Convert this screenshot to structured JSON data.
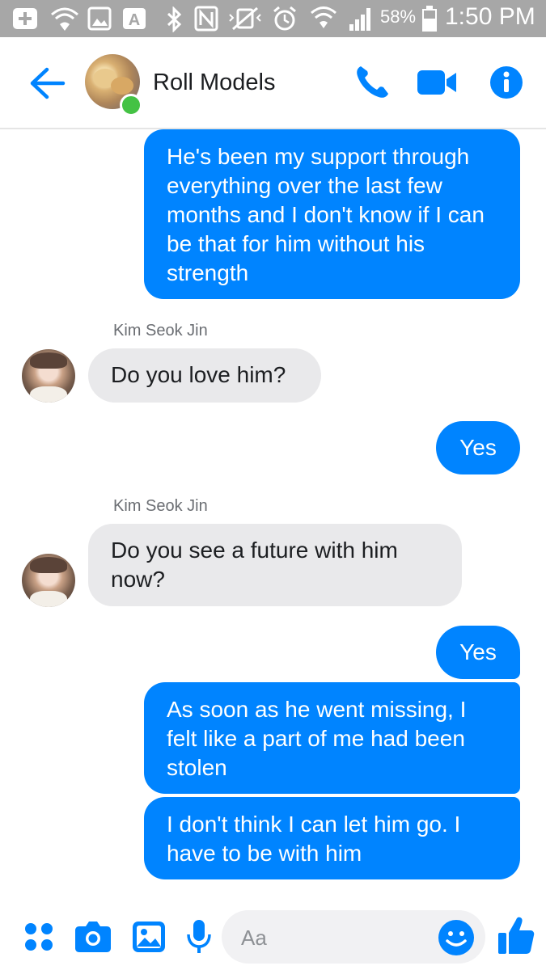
{
  "status_bar": {
    "battery_percent": "58%",
    "time": "1:50 PM"
  },
  "header": {
    "title": "Roll Models",
    "actions": [
      "call",
      "video-call",
      "info"
    ]
  },
  "messages": [
    {
      "direction": "outgoing",
      "text": "He's been my support through everything over the last few months and I don't know if I can be that for him without his strength"
    },
    {
      "direction": "incoming",
      "sender": "Kim Seok Jin",
      "text": "Do you love him?"
    },
    {
      "direction": "outgoing",
      "text": "Yes"
    },
    {
      "direction": "incoming",
      "sender": "Kim Seok Jin",
      "text": "Do you see a future with him now?"
    },
    {
      "direction": "outgoing",
      "text": "Yes"
    },
    {
      "direction": "outgoing",
      "text": "As soon as he went missing, I felt like a part of me had been stolen"
    },
    {
      "direction": "outgoing",
      "text": "I don't think I can let him go. I have to be with him"
    }
  ],
  "composer": {
    "placeholder": "Aa"
  },
  "colors": {
    "accent": "#0084ff",
    "incoming_bubble": "#e9e9eb",
    "status_bar": "#a7a7a7",
    "online": "#44c244"
  }
}
